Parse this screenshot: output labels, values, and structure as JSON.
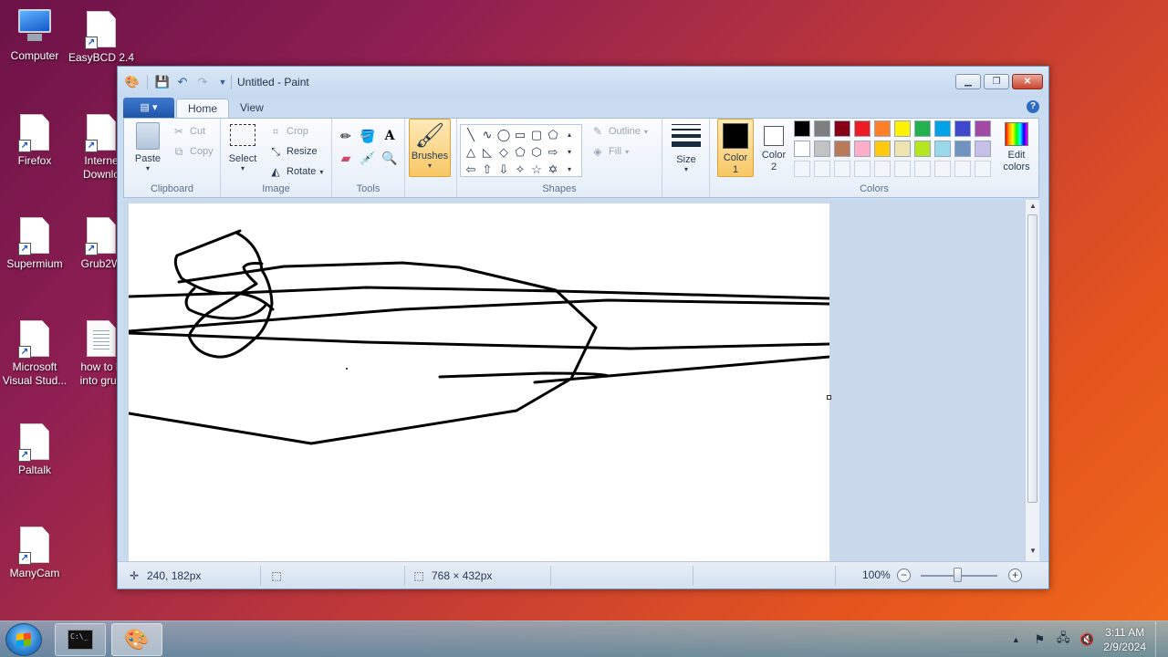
{
  "desktop": {
    "icons": [
      {
        "label": "Computer"
      },
      {
        "label": "EasyBCD 2.4"
      },
      {
        "label": "Firefox"
      },
      {
        "label": "Interne",
        "label2": "Downlo"
      },
      {
        "label": "Supermium"
      },
      {
        "label": "Grub2W"
      },
      {
        "label": "Microsoft",
        "label2": "Visual Stud..."
      },
      {
        "label": "how to b",
        "label2": "into grub"
      },
      {
        "label": "Paltalk"
      },
      {
        "label": "ManyCam"
      }
    ]
  },
  "window": {
    "title": "Untitled - Paint",
    "tabs": [
      {
        "label": "Home"
      },
      {
        "label": "View"
      }
    ]
  },
  "ribbon": {
    "clipboard": {
      "paste": "Paste",
      "cut": "Cut",
      "copy": "Copy",
      "group": "Clipboard"
    },
    "image": {
      "select": "Select",
      "crop": "Crop",
      "resize": "Resize",
      "rotate": "Rotate",
      "group": "Image"
    },
    "tools": {
      "group": "Tools"
    },
    "brushes": {
      "label": "Brushes"
    },
    "shapes": {
      "outline": "Outline",
      "fill": "Fill",
      "group": "Shapes"
    },
    "size": {
      "label": "Size"
    },
    "colors": {
      "color1_label": "Color",
      "color1_num": "1",
      "color2_label": "Color",
      "color2_num": "2",
      "edit_label": "Edit",
      "edit_label2": "colors",
      "group": "Colors",
      "color1": "#000000",
      "color2": "#ffffff",
      "palette_row1": [
        "#000000",
        "#7f7f7f",
        "#880015",
        "#ed1c24",
        "#ff7f27",
        "#fff200",
        "#22b14c",
        "#00a2e8",
        "#3f48cc",
        "#a349a4"
      ],
      "palette_row2": [
        "#ffffff",
        "#c3c3c3",
        "#b97a57",
        "#ffaec9",
        "#ffc90e",
        "#efe4b0",
        "#b5e61d",
        "#99d9ea",
        "#7092be",
        "#c8bfe7"
      ]
    }
  },
  "status": {
    "cursor_pos": "240, 182px",
    "image_size": "768 × 432px",
    "zoom": "100%"
  },
  "taskbar": {
    "time": "3:11 AM",
    "date": "2/9/2024",
    "cmd_text": "C:\\_"
  }
}
